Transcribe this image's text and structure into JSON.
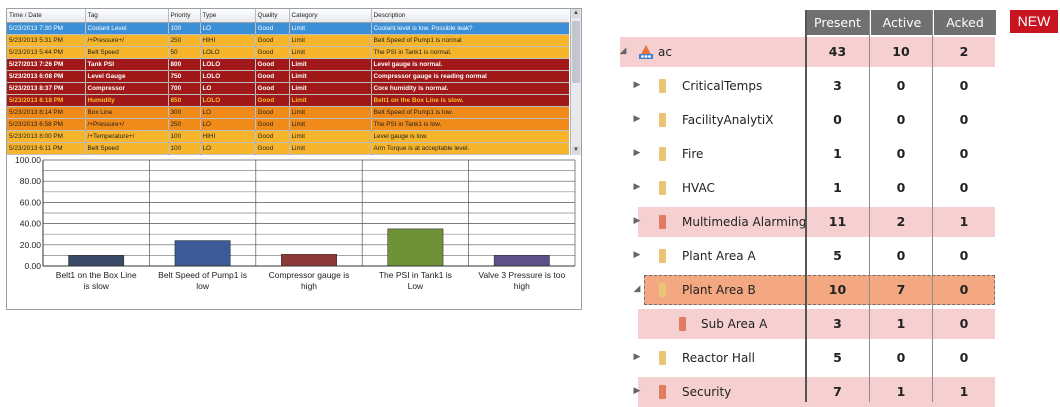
{
  "alarm_grid": {
    "columns": [
      "Time / Date",
      "Tag",
      "Priority",
      "Type",
      "Quality",
      "Category",
      "Description"
    ],
    "rows": [
      {
        "style": "selected",
        "cells": [
          "5/23/2013 7:30 PM",
          "Coolant Level",
          "100",
          "LO",
          "Good",
          "Limit",
          "Coolant level is low.  Possible leak?"
        ]
      },
      {
        "style": "hihi",
        "cells": [
          "5/23/2013 5:31 PM",
          "/+Pressure+/",
          "250",
          "HIHI",
          "Good",
          "Limit",
          "Belt Speed of Pump1 is normal"
        ]
      },
      {
        "style": "hihi",
        "cells": [
          "5/23/2013 5:44 PM",
          "Belt Speed",
          "50",
          "LOLO",
          "Good",
          "Limit",
          "The PSI in Tank1 is normal."
        ]
      },
      {
        "style": "lolo",
        "cells": [
          "5/27/2013 7:26 PM",
          "Tank PSI",
          "800",
          "LOLO",
          "Good",
          "Limit",
          "Level gauge is normal."
        ]
      },
      {
        "style": "lolo",
        "cells": [
          "5/23/2013 6:08 PM",
          "Level Gauge",
          "750",
          "LOLO",
          "Good",
          "Limit",
          "Compressor gauge is reading normal"
        ]
      },
      {
        "style": "lolo",
        "cells": [
          "5/23/2013 8:37 PM",
          "Compressor",
          "700",
          "LO",
          "Good",
          "Limit",
          "Core humidity is normal."
        ]
      },
      {
        "style": "lolo-hl",
        "cells": [
          "5/23/2013 8:18 PM",
          "Humidity",
          "850",
          "LOLO",
          "Good",
          "Limit",
          "Belt1 on the Box Line is slow."
        ]
      },
      {
        "style": "lo",
        "cells": [
          "5/23/2013 8:14 PM",
          "Box Line",
          "300",
          "LO",
          "Good",
          "Limit",
          "Belt Speed of Pump1 is low."
        ]
      },
      {
        "style": "lo",
        "cells": [
          "5/23/2013 6:58 PM",
          "/+Pressure+/",
          "250",
          "LO",
          "Good",
          "Limit",
          "The PSI in Tank1 is low."
        ]
      },
      {
        "style": "hihi",
        "cells": [
          "5/23/2013 8:00 PM",
          "/+Temperature+/",
          "100",
          "HIHI",
          "Good",
          "Limit",
          "Level gauge is low."
        ]
      },
      {
        "style": "hihi",
        "cells": [
          "5/23/2013 6:11 PM",
          "Belt Speed",
          "100",
          "LO",
          "Good",
          "Limit",
          "Arm Torque is at acceptable level."
        ]
      }
    ]
  },
  "chart_data": {
    "type": "bar",
    "title": "",
    "xlabel": "",
    "ylabel": "",
    "ylim": [
      0,
      100
    ],
    "yticks": [
      "0.00",
      "20.00",
      "40.00",
      "60.00",
      "80.00",
      "100.00"
    ],
    "grid": true,
    "legend": "none",
    "categories": [
      [
        "Belt1 on the Box Line",
        "is slow"
      ],
      [
        "Belt Speed of Pump1 is",
        "low"
      ],
      [
        "Compressor gauge is",
        "high"
      ],
      [
        "The PSI in Tank1 is",
        "Low"
      ],
      [
        "Valve 3 Pressure is too",
        "high"
      ]
    ],
    "values": [
      10,
      24,
      11,
      35,
      10
    ],
    "colors": [
      "#3a4a66",
      "#3c5a98",
      "#8a3838",
      "#6f9138",
      "#5c5088"
    ]
  },
  "tree": {
    "columns": [
      "Present",
      "Active",
      "Acked"
    ],
    "rows": [
      {
        "label": "ac",
        "present": "43",
        "active": "10",
        "acked": "2"
      },
      {
        "label": "CriticalTemps",
        "present": "3",
        "active": "0",
        "acked": "0"
      },
      {
        "label": "FacilityAnalytiX",
        "present": "0",
        "active": "0",
        "acked": "0"
      },
      {
        "label": "Fire",
        "present": "1",
        "active": "0",
        "acked": "0"
      },
      {
        "label": "HVAC",
        "present": "1",
        "active": "0",
        "acked": "0"
      },
      {
        "label": "Multimedia Alarming",
        "present": "11",
        "active": "2",
        "acked": "1"
      },
      {
        "label": "Plant Area A",
        "present": "5",
        "active": "0",
        "acked": "0"
      },
      {
        "label": "Plant Area B",
        "present": "10",
        "active": "7",
        "acked": "0"
      },
      {
        "label": "Sub Area A",
        "present": "3",
        "active": "1",
        "acked": "0"
      },
      {
        "label": "Reactor Hall",
        "present": "5",
        "active": "0",
        "acked": "0"
      },
      {
        "label": "Security",
        "present": "7",
        "active": "1",
        "acked": "1"
      }
    ]
  },
  "badge": {
    "label": "NEW"
  },
  "colors": {
    "selected": "#3a8fd6",
    "hihi": "#f7b52b",
    "lolo": "#a01818",
    "lo": "#f08a18",
    "pink": "#f6d0d0",
    "orange_sel": "#f4a882",
    "new_badge": "#c8141e"
  }
}
